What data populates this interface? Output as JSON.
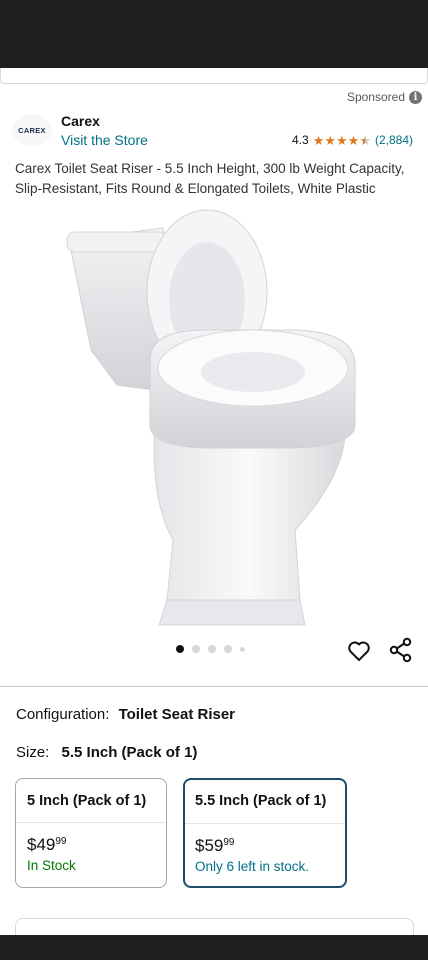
{
  "sponsored": {
    "label": "Sponsored",
    "info_icon": "i"
  },
  "brand": {
    "logo_text": "CAREX",
    "name": "Carex",
    "visit_store": "Visit the Store"
  },
  "rating": {
    "value": "4.3",
    "stars": 4.3,
    "stars_max": 5,
    "count": "(2,884)",
    "star_color": "#de7921"
  },
  "product": {
    "title": "Carex Toilet Seat Riser - 5.5 Inch Height, 300 lb Weight Capacity, Slip-Resistant, Fits Round & Elongated Toilets, White Plastic",
    "image_icon": "toilet-seat-riser-photo"
  },
  "carousel": {
    "total": 5,
    "active_index": 0
  },
  "actions": {
    "wishlist_icon": "heart-icon",
    "share_icon": "share-icon"
  },
  "configuration": {
    "label": "Configuration:",
    "value": "Toilet Seat Riser"
  },
  "size": {
    "label": "Size:",
    "value": "5.5 Inch (Pack of 1)"
  },
  "options": [
    {
      "title": "5 Inch (Pack of 1)",
      "price_dollars": "$49",
      "price_cents": "99",
      "stock": "In Stock",
      "selected": false
    },
    {
      "title": "5.5 Inch (Pack of 1)",
      "price_dollars": "$59",
      "price_cents": "99",
      "stock": "Only 6 left in stock.",
      "selected": true
    }
  ],
  "colors": {
    "link": "#007185",
    "in_stock": "#007600",
    "selected_border": "#1e4c6b",
    "system_bar": "#1f1f21"
  }
}
